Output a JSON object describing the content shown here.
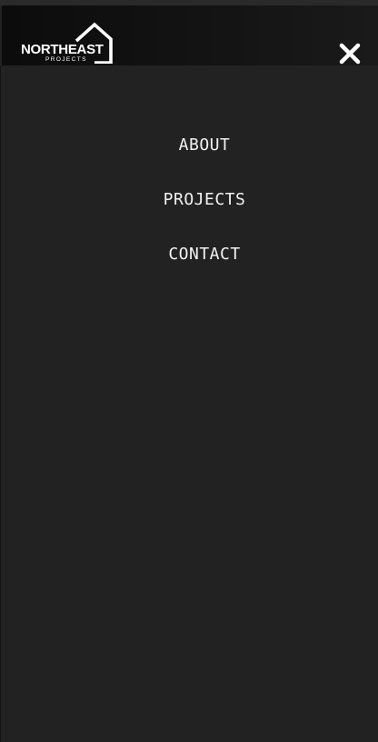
{
  "header": {
    "logo_main": "NORTHEAST",
    "logo_sub": "PROJECTS",
    "close_icon": "close-icon"
  },
  "menu": {
    "items": [
      {
        "label": "ABOUT"
      },
      {
        "label": "PROJECTS"
      },
      {
        "label": "CONTACT"
      }
    ]
  },
  "colors": {
    "background": "#232223",
    "header": "#111111",
    "text": "#f2f2f2"
  }
}
